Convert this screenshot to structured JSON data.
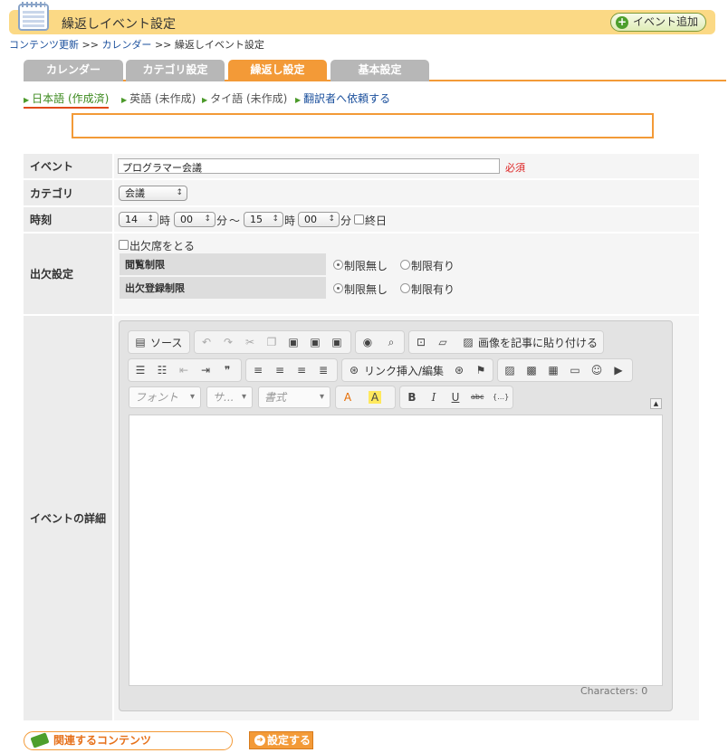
{
  "header": {
    "title": "繰返しイベント設定",
    "add_event_label": "イベント追加"
  },
  "breadcrumb": {
    "items": [
      "コンテンツ更新",
      "カレンダー"
    ],
    "separator": ">>",
    "current": "繰返しイベント設定"
  },
  "tabs": [
    "カレンダー",
    "カテゴリ設定",
    "繰返し設定",
    "基本設定"
  ],
  "languages": [
    "日本語 (作成済)",
    "英語 (未作成)",
    "タイ語 (未作成)",
    "翻訳者へ依頼する"
  ],
  "form": {
    "event": {
      "label": "イベント",
      "value": "プログラマー会議",
      "required": "必須"
    },
    "category": {
      "label": "カテゴリ",
      "value": "会議"
    },
    "time": {
      "label": "時刻",
      "start_hour": "14",
      "start_min": "00",
      "end_hour": "15",
      "end_min": "00",
      "hour_unit": "時",
      "min_unit": "分",
      "tilde": "〜",
      "allday": "終日"
    },
    "attendance": {
      "label": "出欠設定",
      "take_attendance": "出欠席をとる",
      "view_limit": "閲覧制限",
      "register_limit": "出欠登録制限",
      "no_limit": "制限無し",
      "has_limit": "制限有り"
    },
    "detail": {
      "label": "イベントの詳細"
    }
  },
  "editor": {
    "source": "ソース",
    "paste_image": "画像を記事に貼り付ける",
    "link": "リンク挿入/編集",
    "font": "フォント",
    "size": "サ...",
    "format": "書式",
    "characters": "Characters: 0"
  },
  "footer": {
    "related": "関連するコンテンツ",
    "submit": "設定する"
  }
}
